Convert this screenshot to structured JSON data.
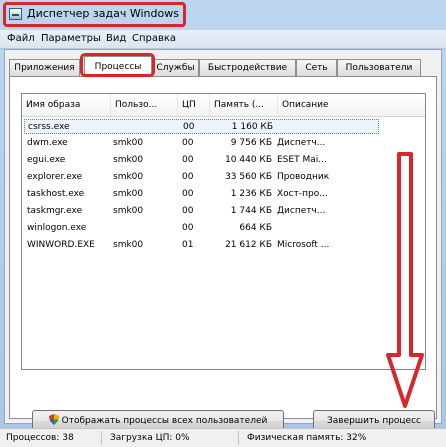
{
  "window": {
    "title": "Диспетчер задач Windows",
    "highlight_color": "#d8262c"
  },
  "menu": [
    "Файл",
    "Параметры",
    "Вид",
    "Справка"
  ],
  "tabs": [
    {
      "label": "Приложения",
      "active": false
    },
    {
      "label": "Процессы",
      "active": true
    },
    {
      "label": "Службы",
      "active": false
    },
    {
      "label": "Быстродействие",
      "active": false
    },
    {
      "label": "Сеть",
      "active": false
    },
    {
      "label": "Пользователи",
      "active": false
    }
  ],
  "columns": [
    "Имя образа",
    "Пользо...",
    "ЦП",
    "Память (...",
    "Описание"
  ],
  "processes": [
    {
      "name": "csrss.exe",
      "user": "",
      "cpu": "00",
      "memory": "1 160 КБ",
      "description": ""
    },
    {
      "name": "dwm.exe",
      "user": "smk00",
      "cpu": "00",
      "memory": "9 756 КБ",
      "description": "Диспетч..."
    },
    {
      "name": "egui.exe",
      "user": "smk00",
      "cpu": "00",
      "memory": "10 440 КБ",
      "description": "ESET Mai..."
    },
    {
      "name": "explorer.exe",
      "user": "smk00",
      "cpu": "00",
      "memory": "33 560 КБ",
      "description": "Проводник"
    },
    {
      "name": "taskhost.exe",
      "user": "smk00",
      "cpu": "00",
      "memory": "1 236 КБ",
      "description": "Хост-про..."
    },
    {
      "name": "taskmgr.exe",
      "user": "smk00",
      "cpu": "00",
      "memory": "1 744 КБ",
      "description": "Диспетч..."
    },
    {
      "name": "winlogon.exe",
      "user": "",
      "cpu": "00",
      "memory": "664 КБ",
      "description": ""
    },
    {
      "name": "WINWORD.EXE",
      "user": "smk00",
      "cpu": "01",
      "memory": "21 612 КБ",
      "description": "Microsoft ..."
    }
  ],
  "selected_process": "csrss.exe",
  "buttons": {
    "show_all": "Отображать процессы всех пользователей",
    "end_process": "Завершить процесс"
  },
  "status": {
    "processes": "Процессов: 38",
    "cpu": "Загрузка ЦП: 0%",
    "memory": "Физическая память: 32%"
  },
  "annotation": {
    "arrow_color": "#d8262c",
    "arrow_direction": "down"
  }
}
